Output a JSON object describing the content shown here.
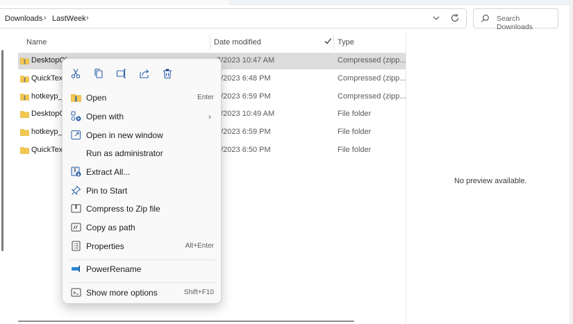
{
  "address": {
    "breadcrumbs": [
      "Downloads",
      "LastWeek"
    ]
  },
  "search": {
    "placeholder": "Search Downloads"
  },
  "columns": {
    "name": "Name",
    "date": "Date modified",
    "type": "Type"
  },
  "files": [
    {
      "name": "DesktopOl",
      "date": "7/2023 10:47 AM",
      "type": "Compressed (zipp...",
      "selected": true,
      "icon": "zip-folder-icon"
    },
    {
      "name": "QuickText",
      "date": "6/2023 6:48 PM",
      "type": "Compressed (zipp...",
      "icon": "zip-folder-icon"
    },
    {
      "name": "hotkeyp_6",
      "date": "6/2023 6:59 PM",
      "type": "Compressed (zipp...",
      "icon": "zip-folder-icon"
    },
    {
      "name": "DesktopO",
      "date": "7/2023 10:49 AM",
      "type": "File folder",
      "icon": "folder-icon"
    },
    {
      "name": "hotkeyp_6",
      "date": "6/2023 6:59 PM",
      "type": "File folder",
      "icon": "folder-icon"
    },
    {
      "name": "QuickText",
      "date": "6/2023 6:50 PM",
      "type": "File folder",
      "icon": "folder-icon"
    }
  ],
  "preview": {
    "text": "No preview available."
  },
  "context_menu": {
    "quick_actions": [
      "cut-icon",
      "copy-icon",
      "rename-icon",
      "share-icon",
      "delete-icon"
    ],
    "items": [
      {
        "label": "Open",
        "shortcut": "Enter",
        "icon": "zip-folder-icon"
      },
      {
        "label": "Open with",
        "shortcut": "",
        "icon": "open-with-icon",
        "submenu": true
      },
      {
        "label": "Open in new window",
        "shortcut": "",
        "icon": "new-window-icon"
      },
      {
        "label": "Run as administrator",
        "shortcut": "",
        "icon": ""
      },
      {
        "label": "Extract All...",
        "shortcut": "",
        "icon": "extract-icon"
      },
      {
        "label": "Pin to Start",
        "shortcut": "",
        "icon": "pin-icon"
      },
      {
        "label": "Compress to Zip file",
        "shortcut": "",
        "icon": "zip-icon"
      },
      {
        "label": "Copy as path",
        "shortcut": "",
        "icon": "copy-path-icon"
      },
      {
        "label": "Properties",
        "shortcut": "Alt+Enter",
        "icon": "properties-icon"
      },
      {
        "label": "PowerRename",
        "shortcut": "",
        "icon": "powerrename-icon"
      },
      {
        "label": "Show more options",
        "shortcut": "Shift+F10",
        "icon": "more-options-icon"
      }
    ]
  }
}
